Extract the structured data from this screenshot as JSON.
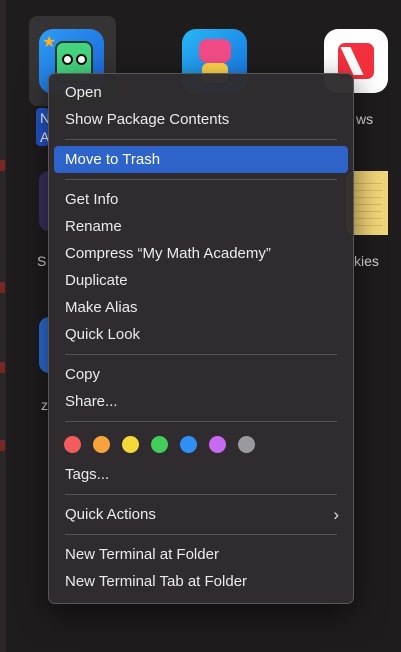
{
  "desktop": {
    "peek_texts": {
      "news_tail": "ws",
      "stickies_tail": "kies",
      "left_mid": "S",
      "left_low": "z"
    },
    "selected_label_initials": [
      "N",
      "A"
    ]
  },
  "menu": {
    "open": "Open",
    "show_package_contents": "Show Package Contents",
    "move_to_trash": "Move to Trash",
    "get_info": "Get Info",
    "rename": "Rename",
    "compress": "Compress “My Math Academy”",
    "duplicate": "Duplicate",
    "make_alias": "Make Alias",
    "quick_look": "Quick Look",
    "copy": "Copy",
    "share": "Share...",
    "tag_colors": [
      {
        "name": "red",
        "color": "#f25c5c"
      },
      {
        "name": "orange",
        "color": "#f5a33a"
      },
      {
        "name": "yellow",
        "color": "#f5d83a"
      },
      {
        "name": "green",
        "color": "#42cc5a"
      },
      {
        "name": "blue",
        "color": "#2f8ff5"
      },
      {
        "name": "purple",
        "color": "#c86af0"
      },
      {
        "name": "gray",
        "color": "#9a9a9e"
      }
    ],
    "tags": "Tags...",
    "quick_actions": "Quick Actions",
    "chevron": "›",
    "new_terminal": "New Terminal at Folder",
    "new_terminal_tab": "New Terminal Tab at Folder"
  },
  "colors": {
    "highlight": "#2e63c9"
  }
}
